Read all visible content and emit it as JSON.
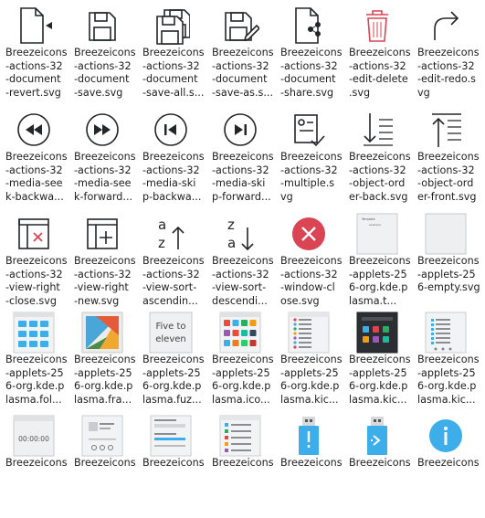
{
  "tiles": [
    {
      "label": "Breezeicons\n-actions-32\n-document\n-revert.svg",
      "icon": "document-revert-icon"
    },
    {
      "label": "Breezeicons\n-actions-32\n-document\n-save.svg",
      "icon": "document-save-icon"
    },
    {
      "label": "Breezeicons\n-actions-32\n-document\n-save-all.s...",
      "icon": "document-save-all-icon"
    },
    {
      "label": "Breezeicons\n-actions-32\n-document\n-save-as.s...",
      "icon": "document-save-as-icon"
    },
    {
      "label": "Breezeicons\n-actions-32\n-document\n-share.svg",
      "icon": "document-share-icon"
    },
    {
      "label": "Breezeicons\n-actions-32\n-edit-delete\n.svg",
      "icon": "edit-delete-icon"
    },
    {
      "label": "Breezeicons\n-actions-32\n-edit-redo.s\nvg",
      "icon": "edit-redo-icon"
    },
    {
      "label": "Breezeicons\n-actions-32\n-media-see\nk-backwa...",
      "icon": "media-seek-backward-icon"
    },
    {
      "label": "Breezeicons\n-actions-32\n-media-see\nk-forward...",
      "icon": "media-seek-forward-icon"
    },
    {
      "label": "Breezeicons\n-actions-32\n-media-ski\np-backwa...",
      "icon": "media-skip-backward-icon"
    },
    {
      "label": "Breezeicons\n-actions-32\n-media-ski\np-forward...",
      "icon": "media-skip-forward-icon"
    },
    {
      "label": "Breezeicons\n-actions-32\n-multiple.s\nvg",
      "icon": "multiple-icon"
    },
    {
      "label": "Breezeicons\n-actions-32\n-object-ord\ner-back.svg",
      "icon": "object-order-back-icon"
    },
    {
      "label": "Breezeicons\n-actions-32\n-object-ord\ner-front.svg",
      "icon": "object-order-front-icon"
    },
    {
      "label": "Breezeicons\n-actions-32\n-view-right\n-close.svg",
      "icon": "view-right-close-icon"
    },
    {
      "label": "Breezeicons\n-actions-32\n-view-right\n-new.svg",
      "icon": "view-right-new-icon"
    },
    {
      "label": "Breezeicons\n-actions-32\n-view-sort-\nascendin...",
      "icon": "view-sort-ascending-icon"
    },
    {
      "label": "Breezeicons\n-actions-32\n-view-sort-\ndescendi...",
      "icon": "view-sort-descending-icon"
    },
    {
      "label": "Breezeicons\n-actions-32\n-window-cl\nose.svg",
      "icon": "window-close-icon"
    },
    {
      "label": "Breezeicons\n-applets-25\n6-org.kde.p\nlasma.t...",
      "icon": "plasma-template-thumbnail-icon",
      "thumb_title": "Template",
      "thumb_sub": "example"
    },
    {
      "label": "Breezeicons\n-applets-25\n6-empty.svg",
      "icon": "empty-applet-icon"
    },
    {
      "label": "Breezeicons\n-applets-25\n6-org.kde.p\nlasma.fol...",
      "icon": "plasma-folder-thumbnail-icon"
    },
    {
      "label": "Breezeicons\n-applets-25\n6-org.kde.p\nlasma.fra...",
      "icon": "plasma-frame-thumbnail-icon"
    },
    {
      "label": "Breezeicons\n-applets-25\n6-org.kde.p\nlasma.fuz...",
      "icon": "plasma-fuzzyclock-thumbnail-icon",
      "thumb_text": "Five to\neleven"
    },
    {
      "label": "Breezeicons\n-applets-25\n6-org.kde.p\nlasma.ico...",
      "icon": "plasma-icontasks-thumbnail-icon"
    },
    {
      "label": "Breezeicons\n-applets-25\n6-org.kde.p\nlasma.kic...",
      "icon": "plasma-kickoff-thumbnail-icon"
    },
    {
      "label": "Breezeicons\n-applets-25\n6-org.kde.p\nlasma.kic...",
      "icon": "plasma-kicker-thumbnail-icon"
    },
    {
      "label": "Breezeicons\n-applets-25\n6-org.kde.p\nlasma.kic...",
      "icon": "plasma-kickerdash-thumbnail-icon"
    },
    {
      "label": "Breezeicons",
      "icon": "timer-thumbnail-icon",
      "thumb_text": "00:00:00"
    },
    {
      "label": "Breezeicons",
      "icon": "mediacontroller-thumbnail-icon"
    },
    {
      "label": "Breezeicons",
      "icon": "notifications-thumbnail-icon"
    },
    {
      "label": "Breezeicons",
      "icon": "settings-thumbnail-icon"
    },
    {
      "label": "Breezeicons",
      "icon": "usb-warning-icon"
    },
    {
      "label": "Breezeicons",
      "icon": "usb-share-icon"
    },
    {
      "label": "Breezeicons",
      "icon": "info-icon"
    }
  ],
  "colors": {
    "icon_stroke": "#232629",
    "red": "#da4453",
    "blue": "#3daee9"
  }
}
